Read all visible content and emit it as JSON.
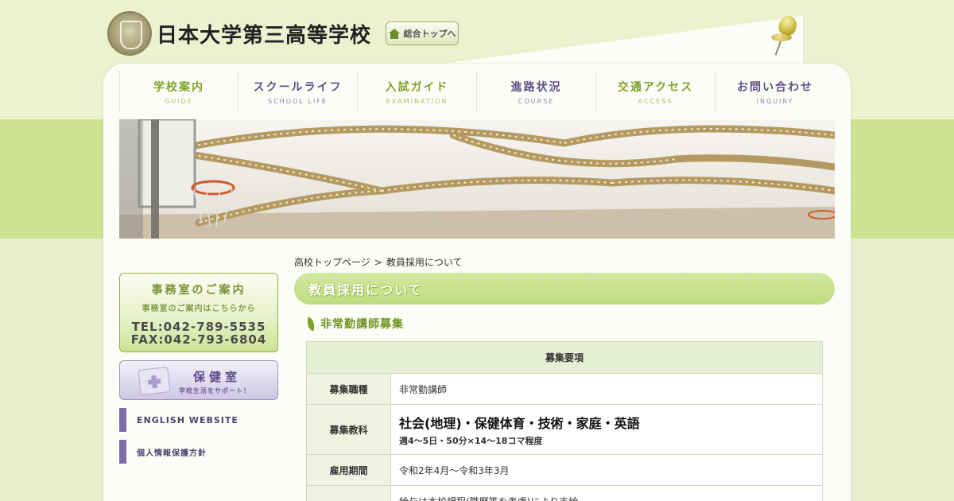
{
  "header": {
    "school_name": "日本大学第三高等学校",
    "top_button_label": "総合トップへ"
  },
  "nav": {
    "items": [
      {
        "ja": "学校案内",
        "en": "GUIDE",
        "color": "#7ea229"
      },
      {
        "ja": "スクールライフ",
        "en": "SCHOOL LIFE",
        "color": "#5f4e8a"
      },
      {
        "ja": "入試ガイド",
        "en": "EXAMINATION",
        "color": "#7ea229"
      },
      {
        "ja": "進路状況",
        "en": "COURSE",
        "color": "#5f4e8a"
      },
      {
        "ja": "交通アクセス",
        "en": "ACCESS",
        "color": "#7ea229"
      },
      {
        "ja": "お問い合わせ",
        "en": "INQUIRY",
        "color": "#5f4e8a"
      }
    ]
  },
  "sidebar": {
    "office": {
      "title": "事務室のご案内",
      "subtitle": "事務室のご案内はこちらから",
      "tel": "TEL:042-789-5535",
      "fax": "FAX:042-793-6804"
    },
    "health": {
      "title": "保健室",
      "subtitle": "学校生活をサポート！"
    },
    "links": {
      "english": "ENGLISH WEBSITE",
      "privacy": "個人情報保護方針"
    }
  },
  "breadcrumb": {
    "home": "高校トップページ",
    "separator": ">",
    "current": "教員採用について"
  },
  "content": {
    "page_title": "教員採用について",
    "section_title": "非常勤講師募集",
    "table": {
      "header": "募集要項",
      "rows": [
        {
          "label": "募集職種",
          "value": "非常勤講師"
        },
        {
          "label": "募集教科",
          "value": "社会(地理)・保健体育・技術・家庭・英語",
          "note": "週4～5日・50分×14～18コマ程度"
        },
        {
          "label": "雇用期間",
          "value": "令和2年4月～令和3年3月"
        },
        {
          "label": "",
          "value": "給与は本校規程(職歴等を考慮)により支給"
        }
      ]
    }
  },
  "colors": {
    "accent_green": "#7ea229",
    "accent_purple": "#5f4e8a",
    "title_bar": "#c6e08c"
  }
}
